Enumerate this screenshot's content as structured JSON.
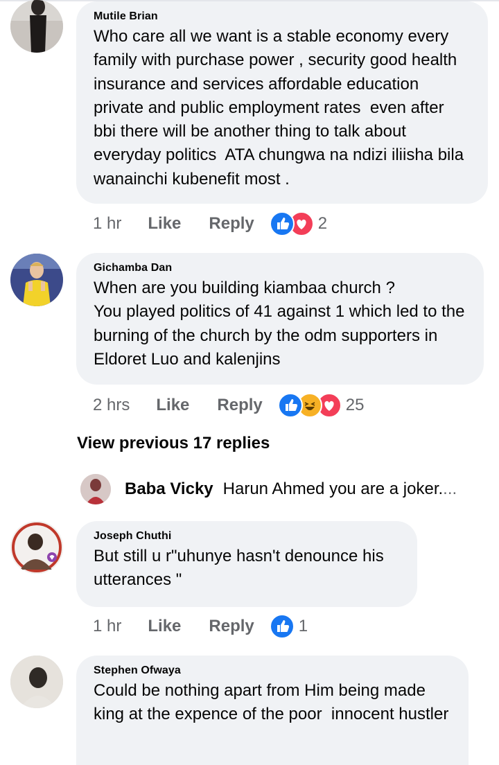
{
  "comments": [
    {
      "author": "Mutile Brian",
      "text": "Who care all we want is a stable economy every family with purchase power , security good health insurance and services affordable education  private and public employment rates  even after bbi there will be another thing to talk about everyday politics  ATA chungwa na ndizi iliisha bila wanainchi kubenefit most .",
      "time": "1 hr",
      "like_label": "Like",
      "reply_label": "Reply",
      "reactions": [
        "like",
        "love"
      ],
      "reaction_count": "2"
    },
    {
      "author": "Gichamba Dan",
      "text": "When are you building kiambaa church ?\nYou played politics of 41 against 1 which led to the burning of the church by the odm supporters in Eldoret Luo and kalenjins",
      "time": "2 hrs",
      "like_label": "Like",
      "reply_label": "Reply",
      "reactions": [
        "like",
        "haha",
        "love"
      ],
      "reaction_count": "25"
    },
    {
      "author": "Joseph Chuthi",
      "text": "But still u r\"uhunye hasn't denounce his utterances \"",
      "time": "1 hr",
      "like_label": "Like",
      "reply_label": "Reply",
      "reactions": [
        "like"
      ],
      "reaction_count": "1"
    },
    {
      "author": "Stephen Ofwaya",
      "text": "Could be nothing apart from Him being made king at the expence of the poor  innocent hustler"
    }
  ],
  "view_previous": "View previous 17 replies",
  "reply_preview": {
    "author": "Baba Vicky",
    "text": "Harun Ahmed you are a joker.",
    "ellipsis": "..."
  },
  "colors": {
    "bubble": "#f0f2f5",
    "meta_text": "#65676b",
    "like_blue": "#1877f2",
    "love_red": "#f33e58",
    "haha_yellow": "#f7b125"
  }
}
